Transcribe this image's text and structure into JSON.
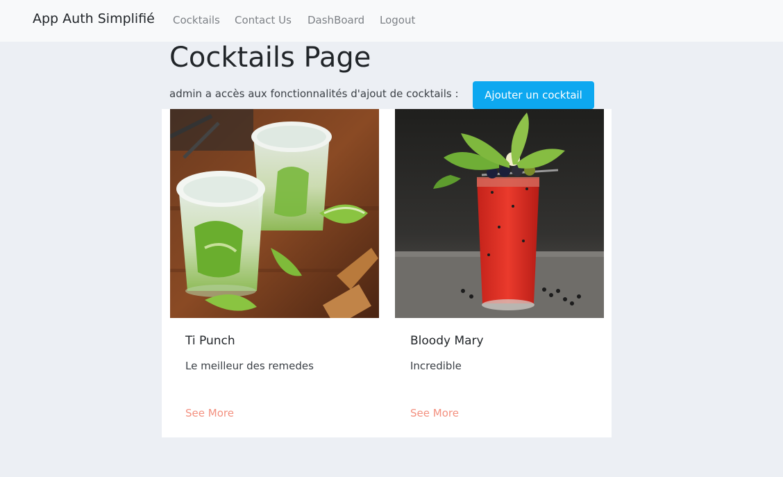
{
  "navbar": {
    "brand": "App Auth Simplifié",
    "links": [
      "Cocktails",
      "Contact Us",
      "DashBoard",
      "Logout"
    ]
  },
  "page": {
    "title": "Cocktails Page",
    "admin_text": "admin a accès aux fonctionnalités d'ajout de cocktails :",
    "add_button": "Ajouter un cocktail"
  },
  "cocktails": [
    {
      "name": "Ti Punch",
      "description": "Le meilleur des remedes",
      "link": "See More"
    },
    {
      "name": "Bloody Mary",
      "description": "Incredible",
      "link": "See More"
    }
  ],
  "colors": {
    "accent_button": "#0da8f0",
    "see_more_link": "#f3907f",
    "page_background": "#eceff4",
    "navbar_background": "#f8f9fa"
  }
}
